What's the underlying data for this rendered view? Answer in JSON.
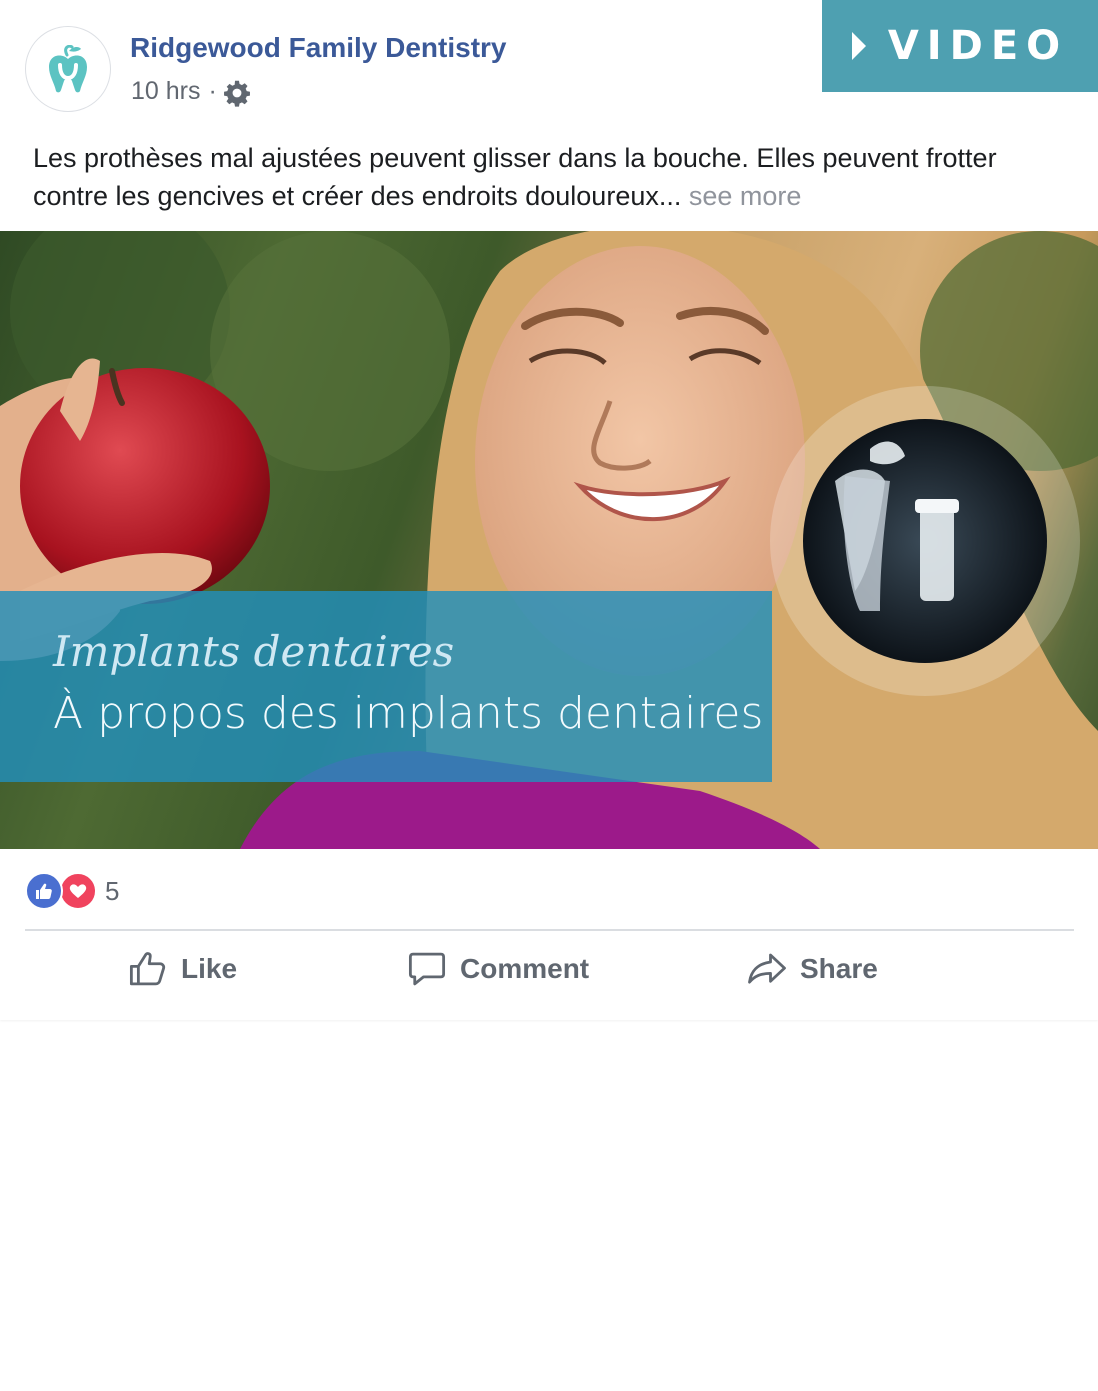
{
  "post": {
    "page_name": "Ridgewood Family Dentistry",
    "time": "10 hrs",
    "separator": "·",
    "badge": {
      "label": "VIDEO",
      "color": "#4ea0b1"
    },
    "text": "Les prothèses mal ajustées peuvent glisser dans la bouche. Elles peuvent frotter contre les gencives et créer des endroits douloureux...",
    "see_more": "see more",
    "media": {
      "title": "Implants dentaires",
      "subtitle": "À propos des implants dentaires"
    },
    "reactions": {
      "count": "5"
    },
    "actions": {
      "like": "Like",
      "comment": "Comment",
      "share": "Share"
    }
  },
  "colors": {
    "brand": "#3b5998",
    "overlay": "#228fbb",
    "logo": "#5cc3c2"
  }
}
